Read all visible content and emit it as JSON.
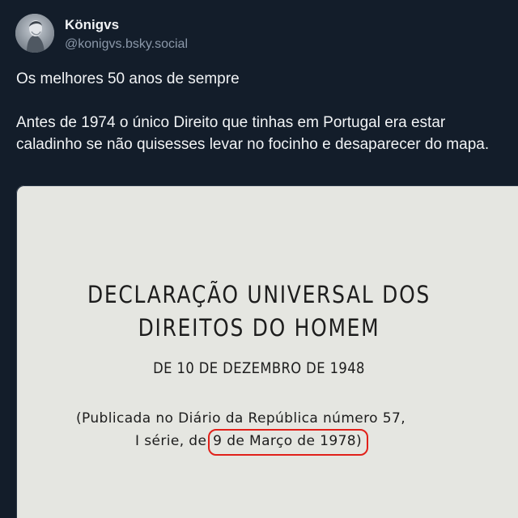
{
  "author": {
    "display_name": "Königvs",
    "handle": "@konigvs.bsky.social"
  },
  "post": {
    "paragraphs": [
      "Os melhores 50 anos de sempre",
      "Antes de 1974 o único Direito que tinhas em Portugal era estar caladinho se não quisesses levar no focinho e desaparecer do mapa."
    ]
  },
  "embedded_image": {
    "title_lines": [
      "DECLARAÇÃO UNIVERSAL DOS",
      "DIREITOS DO HOMEM"
    ],
    "subtitle": "DE 10 DE DEZEMBRO DE 1948",
    "note_line_1": "(Publicada no Diário da República número 57,",
    "note_line_2_prefix": "I série, de ",
    "note_line_2_highlight": "9 de Março de 1978)",
    "highlight_color": "#e1211a",
    "paper_color": "#e5e6e1"
  },
  "colors": {
    "background": "#131d2a",
    "text_primary": "#f1f3f5",
    "text_secondary": "#8b98a9"
  },
  "icons": {
    "avatar": "avatar-statue-photo"
  }
}
